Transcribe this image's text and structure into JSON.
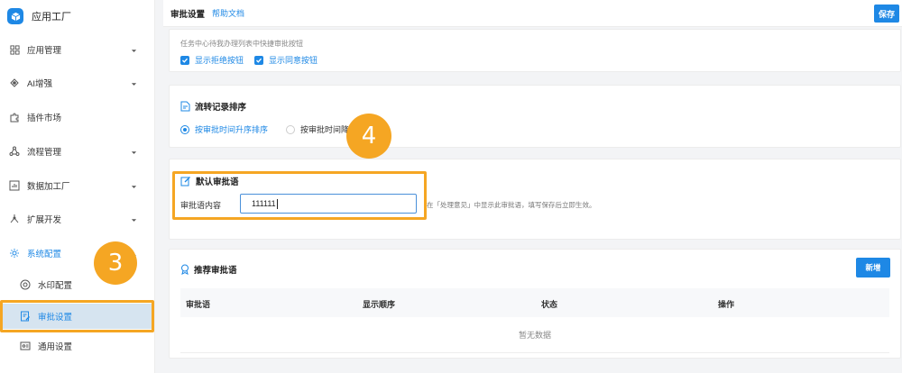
{
  "app": {
    "title": "应用工厂"
  },
  "sidebar": {
    "items": [
      {
        "label": "应用管理",
        "icon": "grid-icon"
      },
      {
        "label": "AI增强",
        "icon": "ai-sparkle-icon"
      },
      {
        "label": "插件市场",
        "icon": "puzzle-icon"
      },
      {
        "label": "流程管理",
        "icon": "flow-icon"
      },
      {
        "label": "数据加工厂",
        "icon": "data-chart-icon"
      },
      {
        "label": "扩展开发",
        "icon": "extension-icon"
      },
      {
        "label": "系统配置",
        "icon": "gear-icon"
      }
    ],
    "sub_items": [
      {
        "label": "水印配置",
        "icon": "watermark-icon"
      },
      {
        "label": "审批设置",
        "icon": "approval-icon"
      },
      {
        "label": "通用设置",
        "icon": "settings-card-icon"
      }
    ]
  },
  "header": {
    "title": "审批设置",
    "help": "帮助文档",
    "save": "保存"
  },
  "quick_buttons": {
    "hint": "任务中心待我办理列表中快捷审批按钮",
    "show_reject": "显示拒绝按钮",
    "show_approve": "显示同意按钮"
  },
  "record_sort": {
    "title": "流转记录排序",
    "option_asc": "按审批时间升序排序",
    "option_desc": "按审批时间降序排序"
  },
  "default_comment": {
    "title": "默认审批语",
    "field_label": "审批语内容",
    "value": "111111",
    "hint": "在「处理意见」中显示此审批语，填写保存后立即生效。"
  },
  "recommended": {
    "title": "推荐审批语",
    "add": "新增",
    "columns": [
      "审批语",
      "显示顺序",
      "状态",
      "操作"
    ],
    "empty": "暂无数据"
  },
  "annotations": {
    "step3": "3",
    "step4": "4"
  },
  "colors": {
    "accent": "#1e88e5",
    "highlight": "#f5a623",
    "selected_bg": "#d6e4f0"
  }
}
